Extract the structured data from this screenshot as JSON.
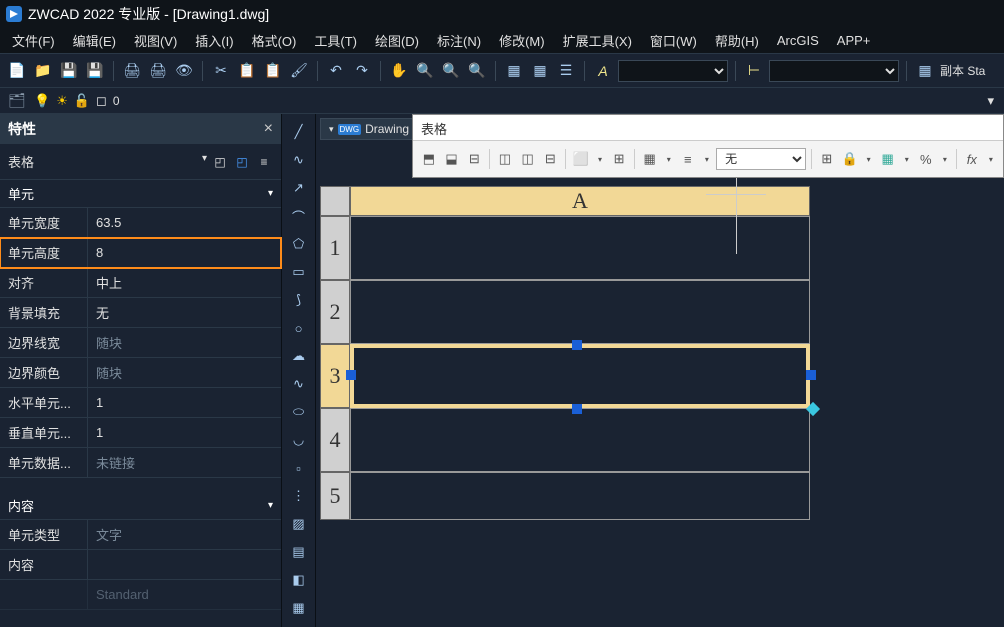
{
  "app": {
    "title": "ZWCAD 2022 专业版 - [Drawing1.dwg]"
  },
  "menu": [
    "文件(F)",
    "编辑(E)",
    "视图(V)",
    "插入(I)",
    "格式(O)",
    "工具(T)",
    "绘图(D)",
    "标注(N)",
    "修改(M)",
    "扩展工具(X)",
    "窗口(W)",
    "帮助(H)",
    "ArcGIS",
    "APP+"
  ],
  "toolbar": {
    "layer_combo": "",
    "style_combo": "",
    "annot_label": "副本 Sta"
  },
  "layerbar": {
    "layer_name": "0"
  },
  "props": {
    "title": "特性",
    "type": "表格",
    "sections": {
      "unit": {
        "title": "单元",
        "rows": [
          {
            "label": "单元宽度",
            "value": "63.5",
            "dim": false
          },
          {
            "label": "单元高度",
            "value": "8",
            "dim": false,
            "highlight": true
          },
          {
            "label": "对齐",
            "value": "中上",
            "dim": false
          },
          {
            "label": "背景填充",
            "value": "无",
            "dim": false
          },
          {
            "label": "边界线宽",
            "value": "随块",
            "dim": true
          },
          {
            "label": "边界颜色",
            "value": "随块",
            "dim": true
          },
          {
            "label": "水平单元...",
            "value": "1",
            "dim": false
          },
          {
            "label": "垂直单元...",
            "value": "1",
            "dim": false
          },
          {
            "label": "单元数据...",
            "value": "未链接",
            "dim": true
          }
        ]
      },
      "content": {
        "title": "内容",
        "rows": [
          {
            "label": "单元类型",
            "value": "文字",
            "dim": true
          },
          {
            "label": "内容",
            "value": "",
            "dim": false
          }
        ],
        "footer": "Standard"
      }
    }
  },
  "doc_tab": {
    "name": "Drawing"
  },
  "table_toolbar": {
    "title": "表格",
    "fill_combo": "无"
  },
  "sheet": {
    "col_label": "A",
    "rows": [
      "1",
      "2",
      "3",
      "4",
      "5"
    ]
  }
}
